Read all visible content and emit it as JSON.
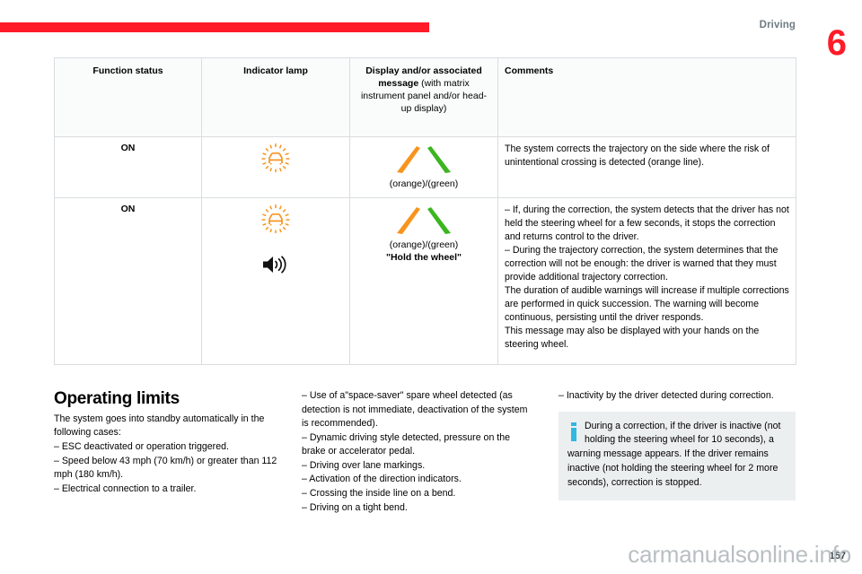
{
  "header": {
    "section_label": "Driving",
    "chapter_number": "6",
    "rule_color": "#ff1b27"
  },
  "table": {
    "columns": [
      {
        "label": "Function status"
      },
      {
        "label": "Indicator lamp"
      },
      {
        "label": "Display and/or associated message",
        "sublabel": "(with matrix instrument panel and/or head-up display)"
      },
      {
        "label": "Comments"
      }
    ],
    "rows": [
      {
        "status": "ON",
        "lamp_icon": "lane-keeping-assist-warning-icon",
        "lamp_icon_color": "#f7941e",
        "audible_icon": null,
        "display_icon": "lane-lines-orange-green-icon",
        "display_caption": "(orange)/(green)",
        "display_message": "",
        "comments": "The system corrects the trajectory on the side where the risk of unintentional crossing is detected (orange line)."
      },
      {
        "status": "ON",
        "lamp_icon": "lane-keeping-assist-warning-icon",
        "lamp_icon_color": "#f7941e",
        "audible_icon": "speaker-icon",
        "display_icon": "lane-lines-orange-green-icon",
        "display_caption": "(orange)/(green)",
        "display_message": "\"Hold the wheel\"",
        "comments": "–  If, during the correction, the system detects that the driver has not held the steering wheel for a few seconds, it stops the correction and returns control to the driver.\n–  During the trajectory correction, the system determines that the correction will not be enough: the driver is warned that they must provide additional trajectory correction.\nThe duration of audible warnings will increase if multiple corrections are performed in quick succession. The warning will become continuous, persisting until the driver responds.\nThis message may also be displayed with your hands on the steering wheel."
      }
    ]
  },
  "body": {
    "column_a": {
      "title": "Operating limits",
      "intro": "The system goes into standby automatically in the following cases:",
      "items": [
        "–  ESC deactivated or operation triggered.",
        "–  Speed below 43 mph (70 km/h) or greater than 112 mph (180 km/h).",
        "–  Electrical connection to a trailer."
      ]
    },
    "column_b": {
      "items": [
        "–  Use of a\"space-saver\" spare wheel detected (as detection is not immediate, deactivation of the system is recommended).",
        "–  Dynamic driving style detected, pressure on the brake or accelerator pedal.",
        "–  Driving over lane markings.",
        "–  Activation of the direction indicators.",
        "–  Crossing the inside line on a bend.",
        "–  Driving on a tight bend."
      ]
    },
    "column_c": {
      "items": [
        "–  Inactivity by the driver detected during correction."
      ],
      "info_box": {
        "icon": "info-i-icon",
        "icon_color": "#2fb8e0",
        "text": "During a correction, if the driver is inactive (not holding the steering wheel for 10 seconds), a warning message appears. If the driver remains inactive (not holding the steering wheel for 2 more seconds), correction is stopped."
      }
    }
  },
  "footer": {
    "page_number": "157",
    "watermark": "carmanualsonline.info"
  }
}
